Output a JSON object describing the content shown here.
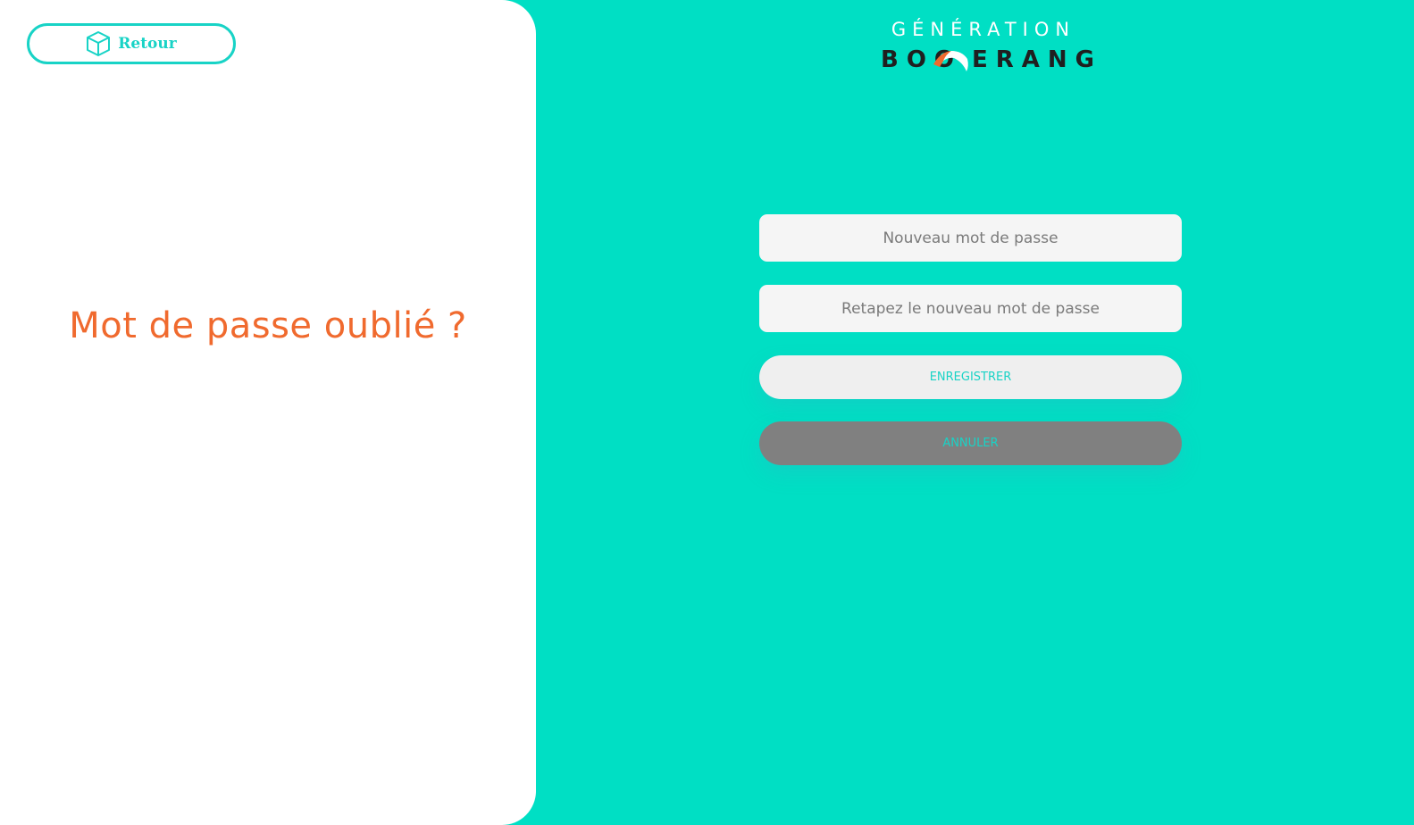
{
  "back_button": {
    "label": "Retour",
    "icon": "cube-icon"
  },
  "title": "Mot de passe oublié ?",
  "logo": {
    "top_text": "GÉNÉRATION",
    "bottom_left": "BOO",
    "bottom_right": "ERANG"
  },
  "form": {
    "new_password_placeholder": "Nouveau mot de passe",
    "confirm_password_placeholder": "Retapez le nouveau mot de passe",
    "save_label": "ENREGISTRER",
    "cancel_label": "ANNULER"
  },
  "colors": {
    "background": "#00dfc4",
    "accent": "#18d3c6",
    "title": "#f06a2e",
    "cancel_bg": "#808080"
  }
}
